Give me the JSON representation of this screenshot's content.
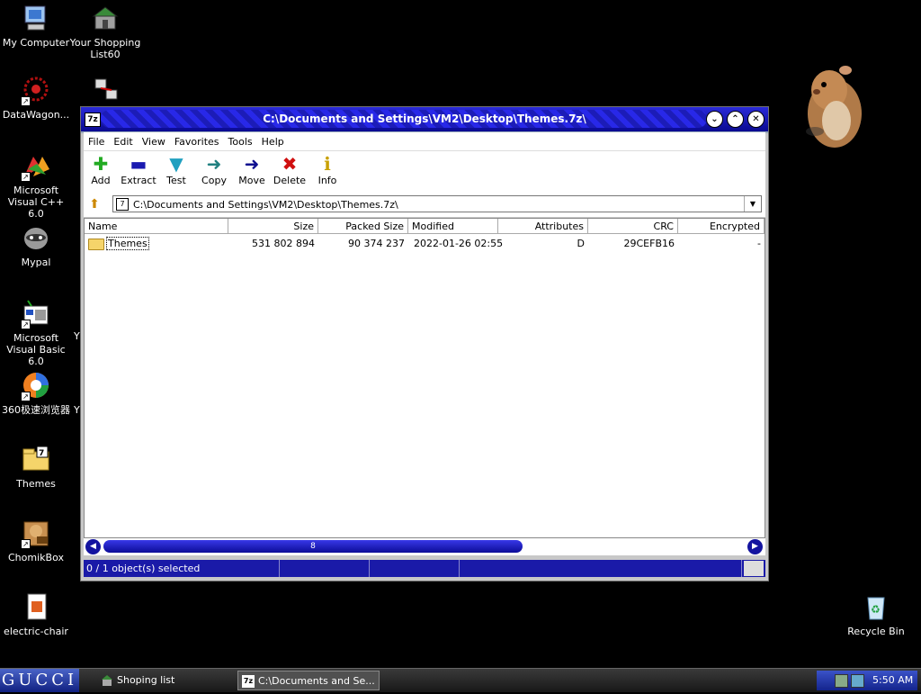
{
  "desktop": {
    "icons": [
      {
        "label": "My Computer"
      },
      {
        "label": "Your Shopping List60"
      },
      {
        "label": "DataWagon..."
      },
      {
        "label": "Microsoft Visual C++ 6.0"
      },
      {
        "label": "Mypal"
      },
      {
        "label": "Microsoft Visual Basic 6.0"
      },
      {
        "label": "360极速浏览器"
      },
      {
        "label": "Themes"
      },
      {
        "label": "ChomikBox"
      },
      {
        "label": "electric-chair"
      },
      {
        "label": "Recycle Bin"
      }
    ],
    "partial_labels": [
      "Y",
      "Y"
    ]
  },
  "window": {
    "title": "C:\\Documents and Settings\\VM2\\Desktop\\Themes.7z\\",
    "app_icon": "7z",
    "menu": [
      "File",
      "Edit",
      "View",
      "Favorites",
      "Tools",
      "Help"
    ],
    "toolbar": [
      {
        "label": "Add",
        "icon": "plus-icon",
        "color": "#22aa22"
      },
      {
        "label": "Extract",
        "icon": "minus-icon",
        "color": "#1a1ab0"
      },
      {
        "label": "Test",
        "icon": "check-icon",
        "color": "#20a0c0"
      },
      {
        "label": "Copy",
        "icon": "copy-arrow-icon",
        "color": "#208080"
      },
      {
        "label": "Move",
        "icon": "move-arrow-icon",
        "color": "#101090"
      },
      {
        "label": "Delete",
        "icon": "delete-x-icon",
        "color": "#d01010"
      },
      {
        "label": "Info",
        "icon": "info-icon",
        "color": "#c8a000"
      }
    ],
    "address": "C:\\Documents and Settings\\VM2\\Desktop\\Themes.7z\\",
    "columns": [
      "Name",
      "Size",
      "Packed Size",
      "Modified",
      "Attributes",
      "CRC",
      "Encrypted"
    ],
    "rows": [
      {
        "name": "Themes",
        "size": "531 802 894",
        "packed": "90 374 237",
        "modified": "2022-01-26 02:55",
        "attributes": "D",
        "crc": "29CEFB16",
        "encrypted": "-"
      }
    ],
    "scroll_thumb": "8",
    "status": "0 / 1 object(s) selected"
  },
  "taskbar": {
    "start": "GUCCI",
    "items": [
      {
        "label": "Shoping list"
      },
      {
        "label": "C:\\Documents and Se..."
      }
    ],
    "clock": "5:50 AM"
  },
  "colors": {
    "accent": "#1a1aa8",
    "desktop": "#000000"
  }
}
